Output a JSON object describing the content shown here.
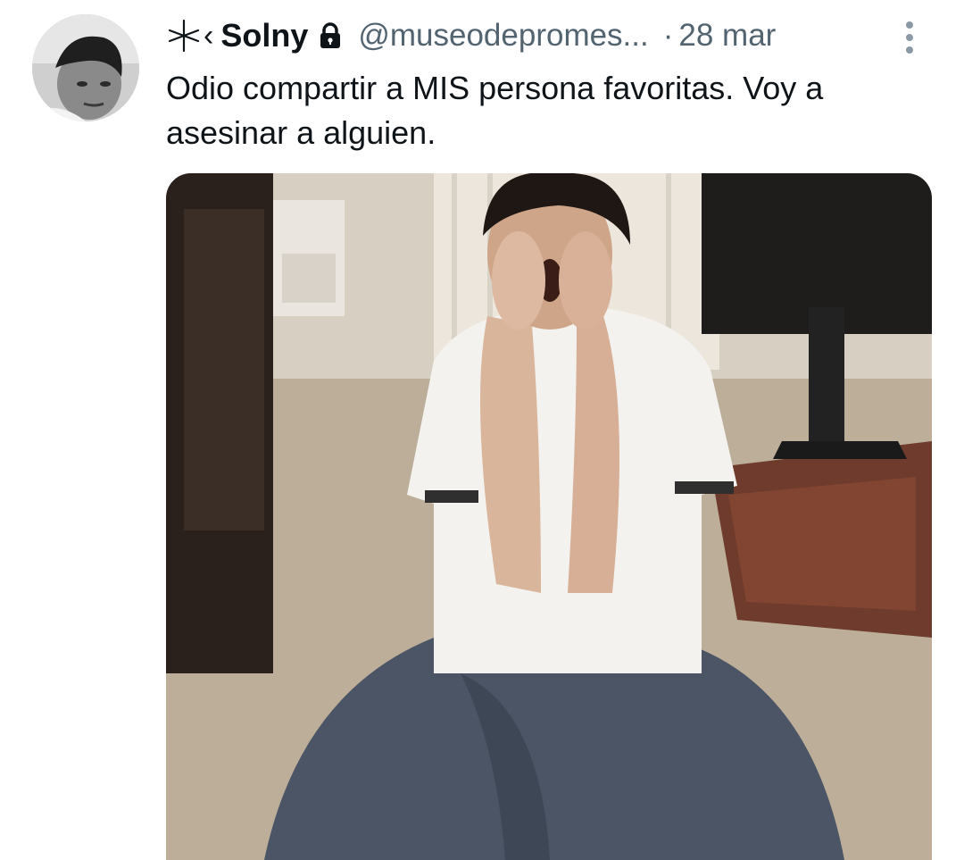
{
  "tweet": {
    "name_prefix": "‹",
    "display_name": "Solny",
    "handle": "@museodepromes...",
    "separator": "·",
    "date": "28 mar",
    "text": "Odio compartir a MIS persona favoritas. Voy a asesinar a alguien."
  },
  "icons": {
    "name_decoration": "star-icon",
    "protected": "lock-icon",
    "menu": "more-vertical-icon"
  },
  "colors": {
    "text_primary": "#0f1419",
    "text_secondary": "#536471",
    "background": "#ffffff"
  }
}
